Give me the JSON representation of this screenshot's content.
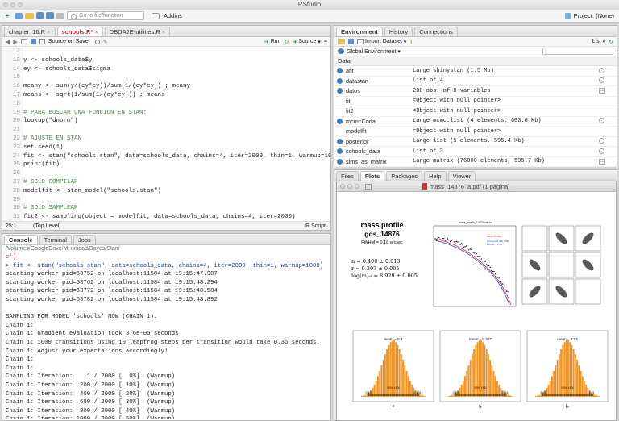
{
  "window_title": "RStudio",
  "toolbar": {
    "goto_placeholder": "Go to file/function",
    "addins": "Addins",
    "project": "Project: (None)"
  },
  "editor": {
    "tabs": [
      "chapter_16.R",
      "schools.R*",
      "DBDA2E-utilities.R"
    ],
    "source_on_save": "Source on Save",
    "run": "Run",
    "source": "Source",
    "lines": [
      {
        "n": "12",
        "t": ""
      },
      {
        "n": "13",
        "t": "y <- schools_data$y"
      },
      {
        "n": "14",
        "t": "ey <- schools_data$sigma"
      },
      {
        "n": "15",
        "t": ""
      },
      {
        "n": "16",
        "t": "meany <- sum(y/(ey*ey))/sum(1/(ey*ey)) ; meany"
      },
      {
        "n": "17",
        "t": "means <- sqrt(1/sum(1/(ey*ey))) ; means"
      },
      {
        "n": "18",
        "t": ""
      },
      {
        "n": "19",
        "t": "# PARA BUSCAR UNA FUNCION EN STAN:"
      },
      {
        "n": "20",
        "t": "lookup(\"dnorm\")"
      },
      {
        "n": "21",
        "t": ""
      },
      {
        "n": "22",
        "t": "# AJUSTE EN STAN"
      },
      {
        "n": "23",
        "t": "set.seed(1)"
      },
      {
        "n": "24",
        "t": "fit <- stan(\"schools.stan\", data=schools_data, chains=4, iter=2000, thin=1, warmup=10("
      },
      {
        "n": "25",
        "t": "print(fit)"
      },
      {
        "n": "26",
        "t": ""
      },
      {
        "n": "27",
        "t": "# SOLO COMPILAR"
      },
      {
        "n": "28",
        "t": "modelfit <- stan_model(\"schools.stan\")"
      },
      {
        "n": "29",
        "t": ""
      },
      {
        "n": "30",
        "t": "# SOLO SAMPLEAR"
      },
      {
        "n": "31",
        "t": "fit2 <- sampling(object = modelfit, data=schools_data, chains=4, iter=2000)"
      },
      {
        "n": "32",
        "t": ""
      }
    ],
    "status_pos": "25:1",
    "status_level": "(Top Level)",
    "status_type": "R Script"
  },
  "console": {
    "tabs": [
      "Console",
      "Terminal",
      "Jobs"
    ],
    "path": "/Volumes/GoogleDrive/Mi unidad/Bayes/Stan/",
    "lines": [
      "c')",
      "> fit <- stan(\"schools.stan\", data=schools_data, chains=4, iter=2000, thin=1, warmup=1000)",
      "starting worker pid=63752 on localhost:11584 at 19:15:47.987",
      "starting worker pid=63762 on localhost:11584 at 19:15:48.294",
      "starting worker pid=63772 on localhost:11584 at 19:15:48.584",
      "starting worker pid=63782 on localhost:11584 at 19:15:48.892",
      "",
      "SAMPLING FOR MODEL 'schools' NOW (CHAIN 1).",
      "Chain 1:",
      "Chain 1: Gradient evaluation took 3.6e-05 seconds",
      "Chain 1: 1000 transitions using 10 leapfrog steps per transition would take 0.36 seconds.",
      "Chain 1: Adjust your expectations accordingly!",
      "Chain 1:",
      "Chain 1:",
      "Chain 1: Iteration:    1 / 2000 [  0%]  (Warmup)",
      "Chain 1: Iteration:  200 / 2000 [ 10%]  (Warmup)",
      "Chain 1: Iteration:  400 / 2000 [ 20%]  (Warmup)",
      "Chain 1: Iteration:  600 / 2000 [ 30%]  (Warmup)",
      "Chain 1: Iteration:  800 / 2000 [ 40%]  (Warmup)",
      "Chain 1: Iteration: 1000 / 2000 [ 50%]  (Warmup)"
    ]
  },
  "env": {
    "tabs": [
      "Environment",
      "History",
      "Connections"
    ],
    "import_dataset": "Import Dataset",
    "list_label": "List",
    "global_env": "Global Environment",
    "section": "Data",
    "rows": [
      {
        "name": "afit",
        "value": "Large shinystan (1.5 Mb)",
        "dot": true,
        "icon": "search"
      },
      {
        "name": "datastan",
        "value": "List of 4",
        "dot": true,
        "icon": "search"
      },
      {
        "name": "datos",
        "value": "200 obs. of 8 variables",
        "dot": true,
        "icon": "grid"
      },
      {
        "name": "fit",
        "value": "<Object with null pointer>",
        "dot": false,
        "icon": "none"
      },
      {
        "name": "fit2",
        "value": "<Object with null pointer>",
        "dot": false,
        "icon": "none"
      },
      {
        "name": "mcmcCoda",
        "value": "Large mcmc.list (4 elements, 603.6 Kb)",
        "dot": true,
        "icon": "search"
      },
      {
        "name": "modelfit",
        "value": "<Object with null pointer>",
        "dot": false,
        "icon": "none"
      },
      {
        "name": "posterior",
        "value": "Large list (5 elements, 595.4 Kb)",
        "dot": true,
        "icon": "search"
      },
      {
        "name": "schools_data",
        "value": "List of 3",
        "dot": true,
        "icon": "search"
      },
      {
        "name": "sims_as_matrix",
        "value": "Large matrix (76000 elements, 595.7 Kb)",
        "dot": true,
        "icon": "grid"
      }
    ]
  },
  "files": {
    "tabs": [
      "Files",
      "Plots",
      "Packages",
      "Help",
      "Viewer"
    ],
    "pdf_title": "mass_14876_a.pdf (1 página)",
    "plot_title1": "mass profile",
    "plot_title2": "gds_14876",
    "fwhm": "FWHM = 0.18 arcsec",
    "params": [
      "n = 0.400 ± 0.013",
      "r = 0.307 ± 0.005",
      "log(m)ₑₗ = 8.929 ± 0.005"
    ],
    "profile_title": "mass_profile_14876.dat.txt",
    "legend": [
      "Sersic Profile",
      "Convolved with PSF",
      "FWHM = 0.18"
    ],
    "hist_means": [
      "mean = 0.4",
      "mean = 0.307",
      "mean = 8.93"
    ],
    "hdi": "95% HDI",
    "hist_xlabels": [
      "n",
      "rₑ",
      "βₑ"
    ],
    "hdi_vals": [
      [
        "0.375",
        "0.426"
      ],
      [
        "0.298",
        "0.316"
      ],
      [
        "8.92",
        "8.94"
      ]
    ]
  }
}
